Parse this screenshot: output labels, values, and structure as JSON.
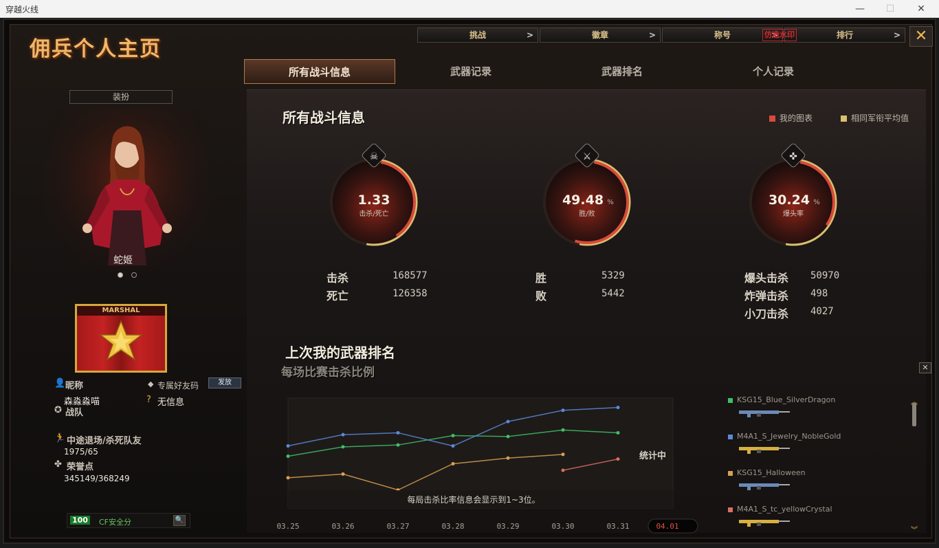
{
  "window": {
    "title": "穿越火线",
    "minimize": "—",
    "maximize": "☐",
    "close": "✕"
  },
  "header": {
    "page_title": "佣兵个人主页",
    "nav": [
      {
        "label": "挑战"
      },
      {
        "label": "徽章"
      },
      {
        "label": "称号"
      },
      {
        "label": "排行"
      }
    ],
    "nav_arrow": ">",
    "watermark": "仿造水印",
    "close": "✕"
  },
  "tabs": [
    {
      "label": "所有战斗信息",
      "active": true
    },
    {
      "label": "武器记录"
    },
    {
      "label": "武器排名"
    },
    {
      "label": "个人记录"
    }
  ],
  "left": {
    "dress_button": "装扮",
    "character_name": "蛇姬",
    "rank_badge": "MARSHAL",
    "nickname_label": "昵称",
    "nickname_value": "森淼淼喵",
    "friend_code_label": "专属好友码",
    "friend_code_button": "发放",
    "no_info": "无信息",
    "team_label": "战队",
    "quit_label": "中途退场/杀死队友",
    "quit_value": "1975/65",
    "honor_label": "荣誉点",
    "honor_value": "345149/368249",
    "cf_score": "100",
    "cf_label": "CF安全分"
  },
  "stats": {
    "section_title": "所有战斗信息",
    "legend_mine": "我的图表",
    "legend_avg": "相同军衔平均值",
    "colors": {
      "mine": "#d84a3a",
      "avg": "#d8c070"
    },
    "rings": [
      {
        "value": "1.33",
        "unit": "",
        "label": "击杀/死亡",
        "fraction": 0.36,
        "icon": "skull-icon"
      },
      {
        "value": "49.48",
        "unit": "%",
        "label": "胜/败",
        "fraction": 0.4948,
        "icon": "crossed-swords-icon"
      },
      {
        "value": "30.24",
        "unit": "%",
        "label": "爆头率",
        "fraction": 0.3024,
        "icon": "rifle-icon"
      }
    ],
    "kd": [
      {
        "label": "击杀",
        "value": "168577"
      },
      {
        "label": "死亡",
        "value": "126358"
      }
    ],
    "wl": [
      {
        "label": "胜",
        "value": "5329"
      },
      {
        "label": "败",
        "value": "5442"
      }
    ],
    "special": [
      {
        "label": "爆头击杀",
        "value": "50970"
      },
      {
        "label": "炸弹击杀",
        "value": "498"
      },
      {
        "label": "小刀击杀",
        "value": "4027"
      }
    ]
  },
  "weapon_rank": {
    "title": "上次我的武器排名",
    "subtitle": "每场比赛击杀比例",
    "pending": "统计中",
    "note": "每局击杀比率信息会显示到1~3位。",
    "close": "✕",
    "weapons": [
      {
        "name": "KSG15_Blue_SilverDragon",
        "color": "#3fbf6a"
      },
      {
        "name": "M4A1_S_Jewelry_NobleGold",
        "color": "#5a8ad8"
      },
      {
        "name": "KSG15_Halloween",
        "color": "#d8a050"
      },
      {
        "name": "M4A1_S_tc_yellowCrystal",
        "color": "#d87060"
      }
    ]
  },
  "chart_data": {
    "type": "line",
    "x": [
      "03.25",
      "03.26",
      "03.27",
      "03.28",
      "03.29",
      "03.30",
      "03.31",
      "04.01"
    ],
    "series": [
      {
        "name": "KSG15_Blue_SilverDragon",
        "color": "#3fbf6a",
        "values": [
          0.48,
          0.58,
          0.6,
          0.7,
          0.69,
          0.76,
          0.73,
          null
        ]
      },
      {
        "name": "M4A1_S_Jewelry_NobleGold",
        "color": "#5a8ad8",
        "values": [
          0.59,
          0.71,
          0.73,
          0.59,
          0.85,
          0.97,
          1.0,
          null
        ]
      },
      {
        "name": "KSG15_Halloween",
        "color": "#d8a050",
        "values": [
          0.25,
          0.29,
          0.12,
          0.4,
          0.46,
          0.5,
          null,
          null
        ]
      },
      {
        "name": "M4A1_S_tc_yellowCrystal",
        "color": "#d87060",
        "values": [
          null,
          null,
          null,
          null,
          null,
          0.33,
          0.45,
          null
        ]
      }
    ],
    "highlight_x": "04.01",
    "ylim": [
      0,
      1.1
    ]
  }
}
